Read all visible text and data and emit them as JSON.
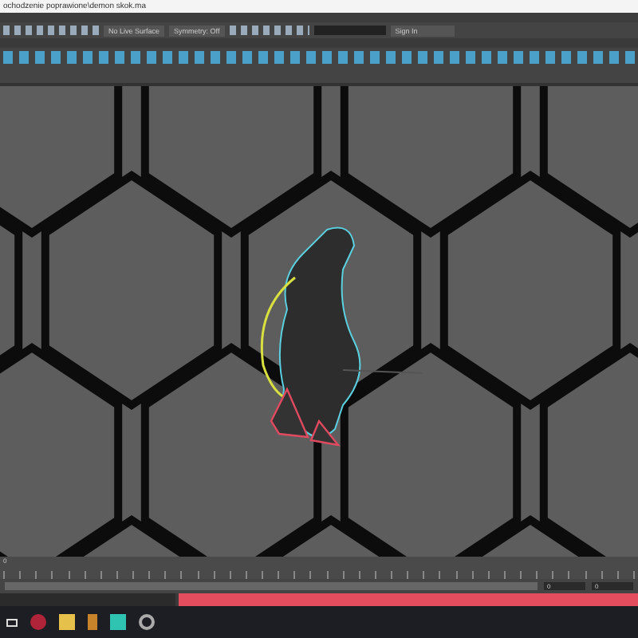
{
  "window": {
    "title": "ochodzenie poprawione\\demon skok.ma"
  },
  "status_line": {
    "live_surface": "No Live Surface",
    "symmetry": "Symmetry: Off",
    "account": "Sign In"
  },
  "timeline": {
    "current_frame": "0"
  },
  "range": {
    "start": "0",
    "end": "0"
  }
}
